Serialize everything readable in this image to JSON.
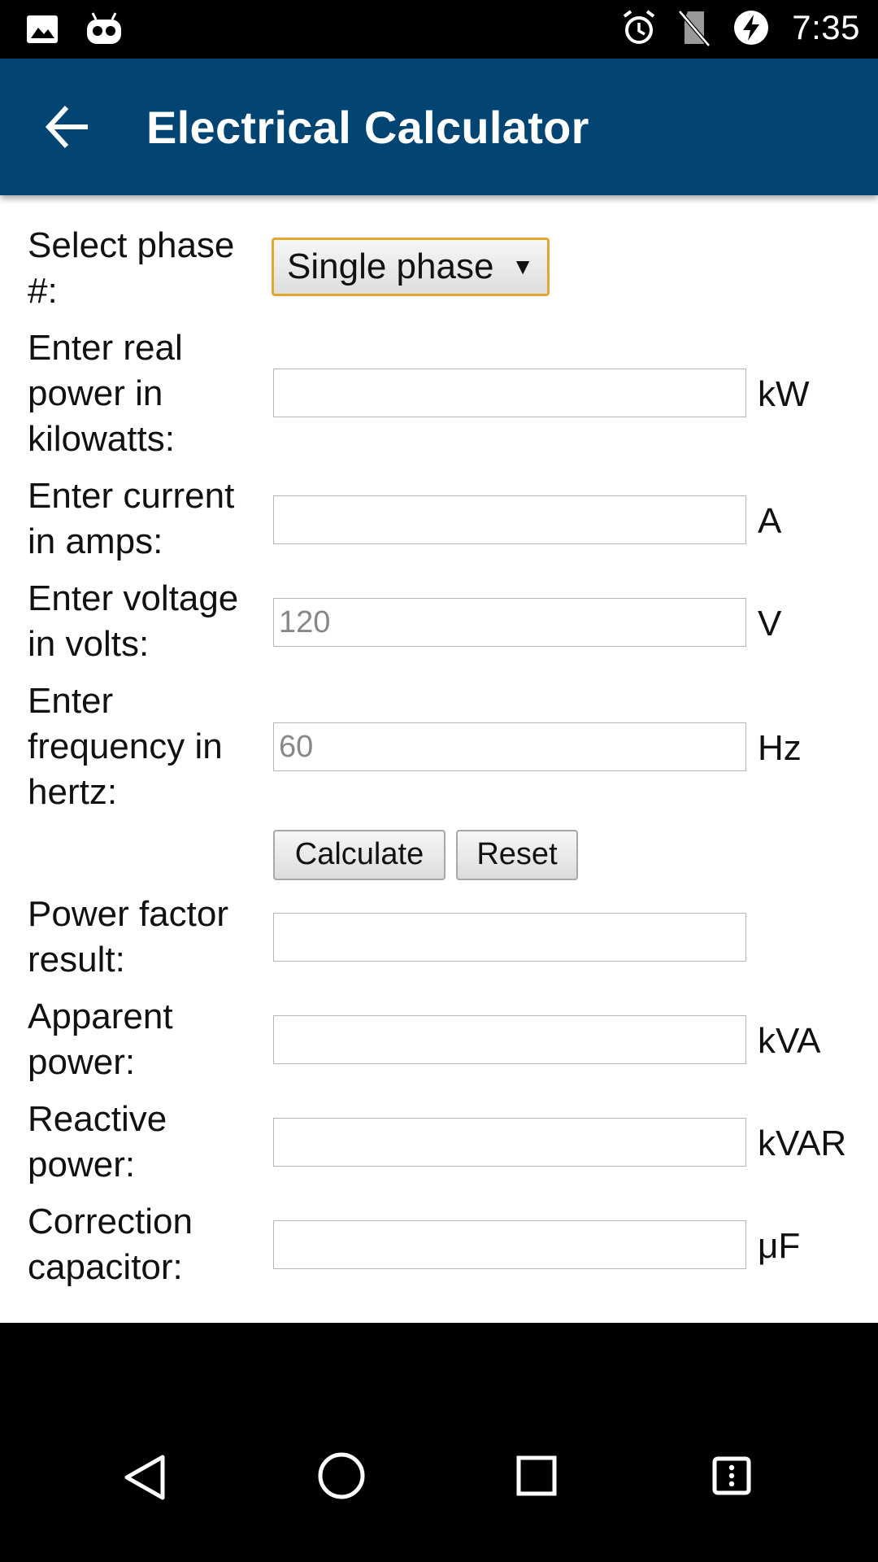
{
  "status_bar": {
    "time": "7:35",
    "icons": [
      "image-icon",
      "android-robot-icon",
      "alarm-icon",
      "no-sim-icon",
      "battery-charging-icon"
    ]
  },
  "app_bar": {
    "title": "Electrical Calculator",
    "back_icon": "arrow-back-icon",
    "color": "#024572"
  },
  "form": {
    "phase_label": "Select phase #:",
    "phase_selected": "Single phase",
    "real_power_label": "Enter real power in kilowatts:",
    "real_power_unit": "kW",
    "current_label": "Enter current in amps:",
    "current_unit": "A",
    "voltage_label": "Enter voltage in volts:",
    "voltage_placeholder": "120",
    "voltage_unit": "V",
    "frequency_label": "Enter frequency in hertz:",
    "frequency_placeholder": "60",
    "frequency_unit": "Hz",
    "calculate_label": "Calculate",
    "reset_label": "Reset"
  },
  "results": {
    "power_factor_label": "Power factor result:",
    "apparent_power_label": "Apparent power:",
    "apparent_power_unit": "kVA",
    "reactive_power_label": "Reactive power:",
    "reactive_power_unit": "kVAR",
    "capacitor_label": "Correction capacitor:",
    "capacitor_unit": "μF"
  },
  "nav_bar": {
    "icons": [
      "back-triangle-icon",
      "home-circle-icon",
      "recents-square-icon",
      "menu-icon"
    ]
  }
}
